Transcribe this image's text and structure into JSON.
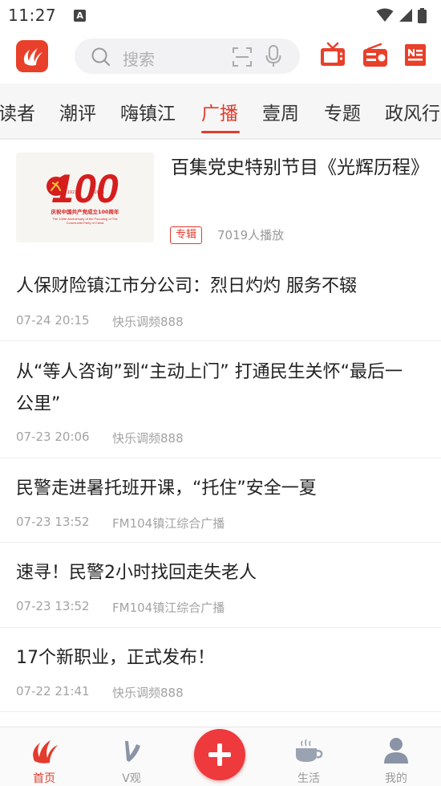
{
  "status_bar": {
    "time": "11:27",
    "notification_letter": "A"
  },
  "header": {
    "search_placeholder": "搜索"
  },
  "tabs": [
    "读者",
    "潮评",
    "嗨镇江",
    "广播",
    "壹周",
    "专题",
    "政风行"
  ],
  "active_tab": "广播",
  "featured": {
    "thumb_number": "100",
    "thumb_years_left": "1921",
    "thumb_years_right": "2021",
    "thumb_caption_cn": "庆祝中国共产党成立100周年",
    "thumb_caption_en": "The 100th Anniversary of the Founding of The Communist Party of China",
    "title": "百集党史特别节目《光辉历程》",
    "badge": "专辑",
    "plays": "7019人播放"
  },
  "news": [
    {
      "title": "人保财险镇江市分公司：烈日灼灼 服务不辍",
      "date": "07-24 20:15",
      "source": "快乐调频888"
    },
    {
      "title": "从“等人咨询”到“主动上门” 打通民生关怀“最后一公里”",
      "date": "07-23 20:06",
      "source": "快乐调频888"
    },
    {
      "title": "民警走进暑托班开课，“托住”安全一夏",
      "date": "07-23 13:52",
      "source": "FM104镇江综合广播"
    },
    {
      "title": "速寻！民警2小时找回走失老人",
      "date": "07-23 13:52",
      "source": "FM104镇江综合广播"
    },
    {
      "title": "17个新职业，正式发布！",
      "date": "07-22 21:41",
      "source": "快乐调频888"
    }
  ],
  "bottom_nav": {
    "home": "首页",
    "video": "V观",
    "life": "生活",
    "mine": "我的"
  },
  "colors": {
    "accent": "#e33b2c",
    "logo": "#e8402a",
    "add_button": "#ee3a3d"
  }
}
